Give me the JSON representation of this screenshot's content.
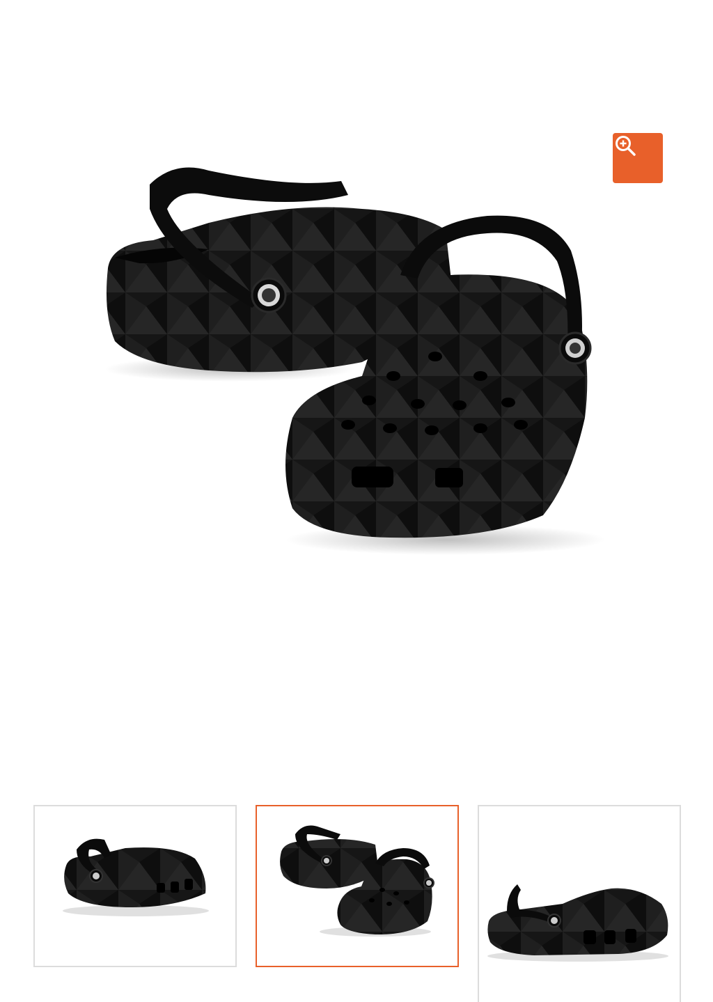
{
  "colors": {
    "accent": "#e8602a",
    "thumb_border": "#dcdcdc",
    "shoe": "#141414"
  },
  "gallery": {
    "zoom_icon": "zoom-in-icon",
    "selected_index": 1,
    "thumbnails": [
      {
        "view": "side-angle"
      },
      {
        "view": "pair-front"
      },
      {
        "view": "side-profile"
      }
    ]
  }
}
